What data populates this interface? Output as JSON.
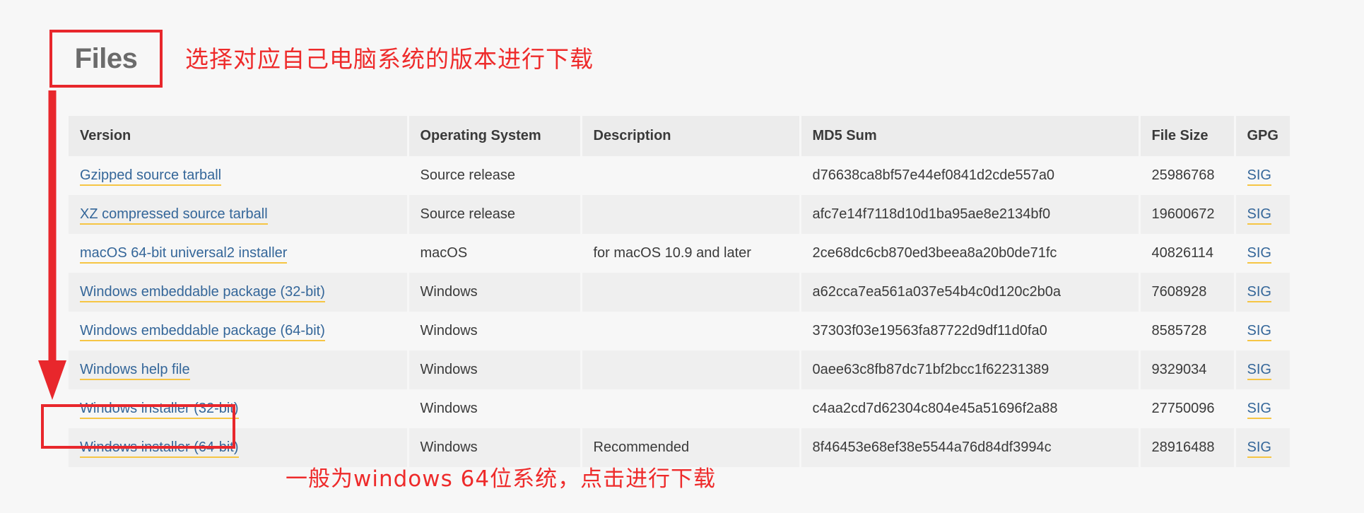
{
  "heading": {
    "title": "Files",
    "top_annotation": "选择对应自己电脑系统的版本进行下载",
    "bottom_annotation": "一般为windows 64位系统，点击进行下载"
  },
  "annotation_color": "#ee2b2b",
  "link_color": "#346699",
  "link_underline_color": "#f6c544",
  "table": {
    "columns": [
      "Version",
      "Operating System",
      "Description",
      "MD5 Sum",
      "File Size",
      "GPG"
    ],
    "gpg_label": "SIG",
    "rows": [
      {
        "version": "Gzipped source tarball",
        "os": "Source release",
        "description": "",
        "md5": "d76638ca8bf57e44ef0841d2cde557a0",
        "size": "25986768",
        "gpg": "SIG"
      },
      {
        "version": "XZ compressed source tarball",
        "os": "Source release",
        "description": "",
        "md5": "afc7e14f7118d10d1ba95ae8e2134bf0",
        "size": "19600672",
        "gpg": "SIG"
      },
      {
        "version": "macOS 64-bit universal2 installer",
        "os": "macOS",
        "description": "for macOS 10.9 and later",
        "md5": "2ce68dc6cb870ed3beea8a20b0de71fc",
        "size": "40826114",
        "gpg": "SIG"
      },
      {
        "version": "Windows embeddable package (32-bit)",
        "os": "Windows",
        "description": "",
        "md5": "a62cca7ea561a037e54b4c0d120c2b0a",
        "size": "7608928",
        "gpg": "SIG"
      },
      {
        "version": "Windows embeddable package (64-bit)",
        "os": "Windows",
        "description": "",
        "md5": "37303f03e19563fa87722d9df11d0fa0",
        "size": "8585728",
        "gpg": "SIG"
      },
      {
        "version": "Windows help file",
        "os": "Windows",
        "description": "",
        "md5": "0aee63c8fb87dc71bf2bcc1f62231389",
        "size": "9329034",
        "gpg": "SIG"
      },
      {
        "version": "Windows installer (32-bit)",
        "os": "Windows",
        "description": "",
        "md5": "c4aa2cd7d62304c804e45a51696f2a88",
        "size": "27750096",
        "gpg": "SIG"
      },
      {
        "version": "Windows installer (64-bit)",
        "os": "Windows",
        "description": "Recommended",
        "md5": "8f46453e68ef38e5544a76d84df3994c",
        "size": "28916488",
        "gpg": "SIG"
      }
    ]
  }
}
